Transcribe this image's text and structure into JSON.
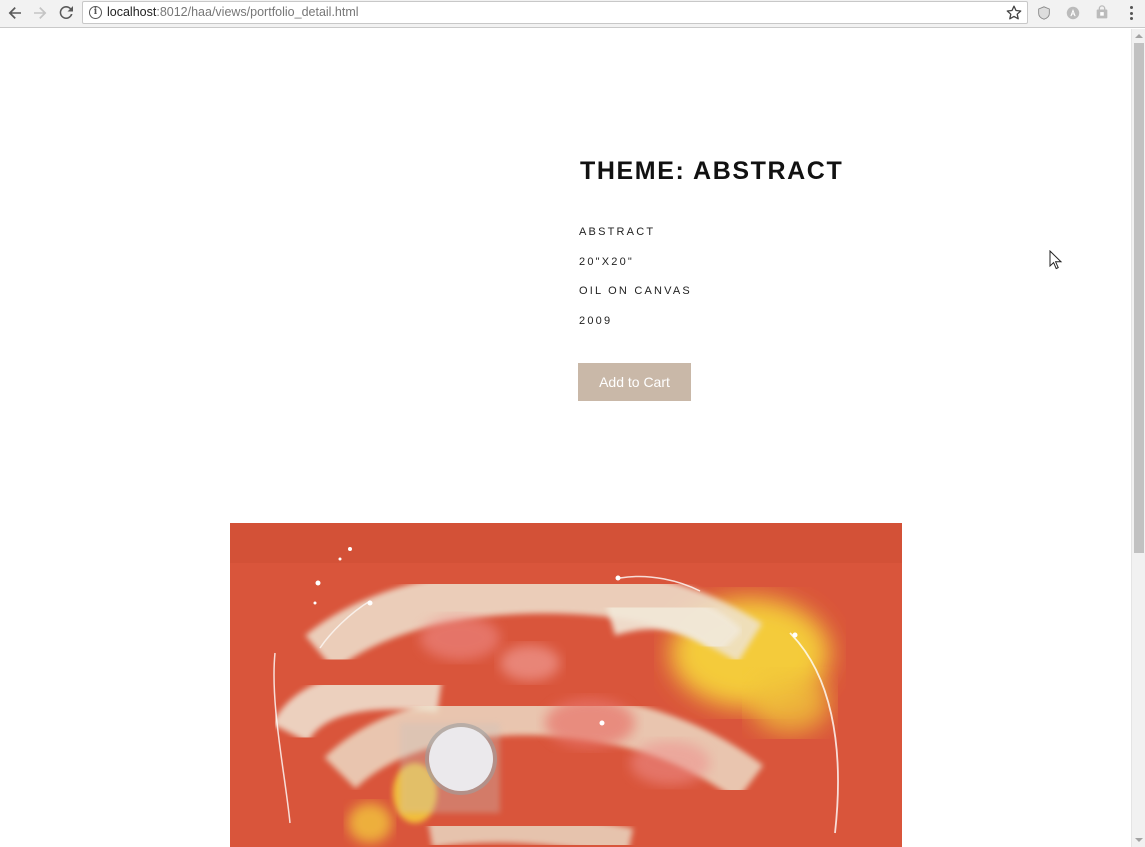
{
  "browser": {
    "url_host": "localhost",
    "url_rest": ":8012/haa/views/portfolio_detail.html",
    "icons": {
      "back": "back-arrow-icon",
      "forward": "forward-arrow-icon",
      "reload": "reload-icon",
      "info": "info-icon",
      "bookmark": "star-icon",
      "menu": "kebab-menu-icon"
    }
  },
  "artwork": {
    "title": "THEME: ABSTRACT",
    "details": [
      "ABSTRACT",
      "20\"X20\"",
      "OIL ON CANVAS",
      "2009"
    ],
    "add_to_cart_label": "Add to Cart"
  },
  "colors": {
    "button": "#c9b8a8",
    "painting_base": "#d8543a"
  }
}
